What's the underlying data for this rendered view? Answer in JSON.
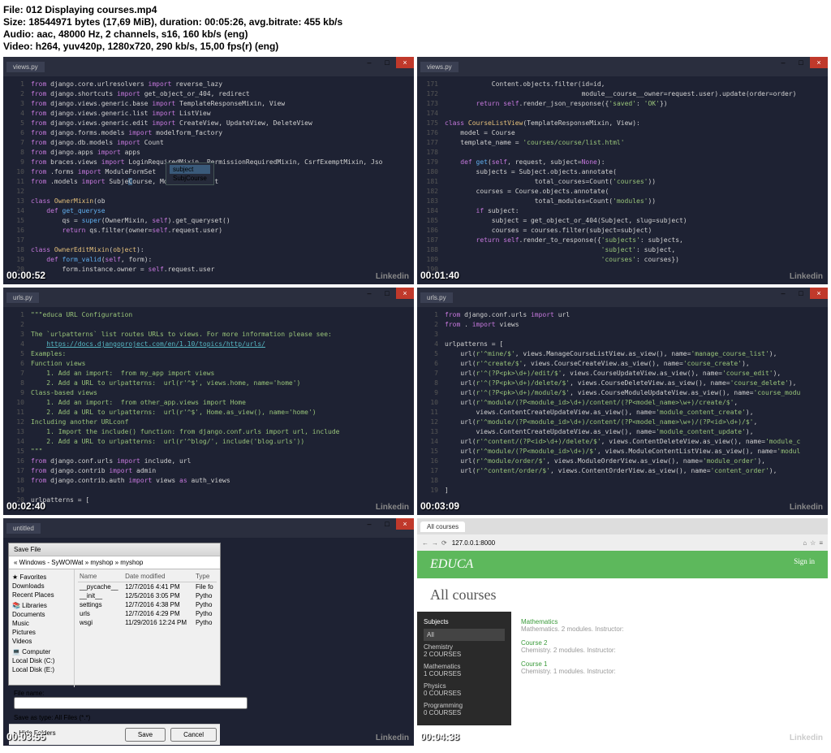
{
  "info": {
    "file": "File: 012 Displaying courses.mp4",
    "size": "Size: 18544971 bytes (17,69 MiB), duration: 00:05:26, avg.bitrate: 455 kb/s",
    "audio": "Audio: aac, 48000 Hz, 2 channels, s16, 160 kb/s (eng)",
    "video": "Video: h264, yuv420p, 1280x720, 290 kb/s, 15,00 fps(r) (eng)"
  },
  "wm": "Linkedin",
  "frames": [
    {
      "ts": "00:00:52",
      "tab": "views.py"
    },
    {
      "ts": "00:01:40",
      "tab": "views.py"
    },
    {
      "ts": "00:02:40",
      "tab": "urls.py"
    },
    {
      "ts": "00:03:09",
      "tab": "urls.py"
    },
    {
      "ts": "00:03:55",
      "tab": "untitled"
    },
    {
      "ts": "00:04:38",
      "tab": "All courses"
    }
  ],
  "ac": {
    "a": "subject",
    "b": "SubjCourse"
  },
  "explorer": {
    "title": "Save File",
    "path": "« Windows - SyWOIWat » myshop » myshop",
    "side": [
      "★ Favorites",
      "  Downloads",
      "  Recent Places",
      "",
      "📚 Libraries",
      "  Documents",
      "  Music",
      "  Pictures",
      "  Videos",
      "",
      "💻 Computer",
      "  Local Disk (C:)",
      "  Local Disk (E:)"
    ],
    "headers": [
      "Name",
      "Date modified",
      "Type"
    ],
    "files": [
      [
        "__pycache__",
        "12/7/2016 4:41 PM",
        "File fo"
      ],
      [
        "__init__",
        "12/5/2016 3:05 PM",
        "Pytho"
      ],
      [
        "settings",
        "12/7/2016 4:38 PM",
        "Pytho"
      ],
      [
        "urls",
        "12/7/2016 4:29 PM",
        "Pytho"
      ],
      [
        "wsgi",
        "11/29/2016 12:24 PM",
        "Pytho"
      ]
    ],
    "filename": "File name:",
    "saveas": "Save as type:  All Files (*.*)",
    "save": "Save",
    "cancel": "Cancel",
    "hide": "▸ Hide Folders"
  },
  "browser": {
    "addr": "127.0.0.1:8000",
    "brand": "EDUCA",
    "signin": "Sign in",
    "h1": "All courses",
    "subhdr": "Subjects",
    "subjects": [
      {
        "name": "All",
        "sel": true
      },
      {
        "name": "Chemistry",
        "count": "2 COURSES"
      },
      {
        "name": "Mathematics",
        "count": "1 COURSES"
      },
      {
        "name": "Physics",
        "count": "0 COURSES"
      },
      {
        "name": "Programming",
        "count": "0 COURSES"
      }
    ],
    "courses": [
      {
        "name": "Mathematics",
        "meta": "Mathematics. 2 modules. Instructor:"
      },
      {
        "name": "Course 2",
        "meta": "Chemistry. 2 modules. Instructor:"
      },
      {
        "name": "Course 1",
        "meta": "Chemistry. 1 modules. Instructor:"
      }
    ]
  }
}
